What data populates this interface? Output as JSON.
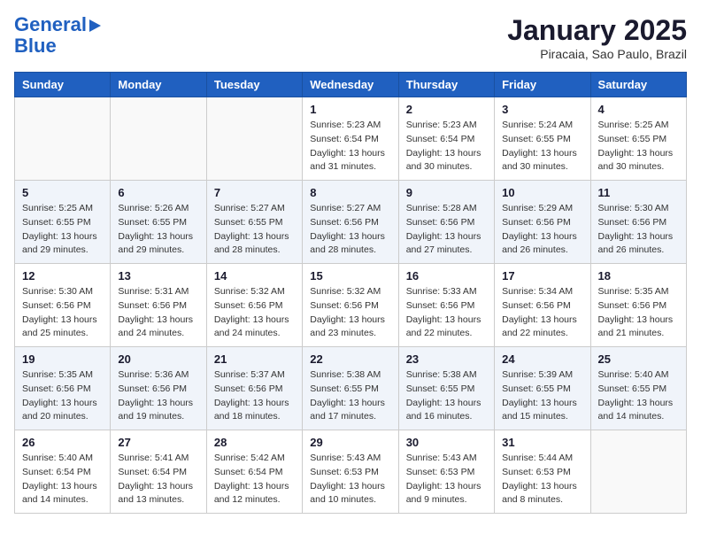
{
  "header": {
    "logo_line1": "General",
    "logo_line2": "Blue",
    "month_title": "January 2025",
    "subtitle": "Piracaia, Sao Paulo, Brazil"
  },
  "weekdays": [
    "Sunday",
    "Monday",
    "Tuesday",
    "Wednesday",
    "Thursday",
    "Friday",
    "Saturday"
  ],
  "weeks": [
    [
      {
        "day": "",
        "info": ""
      },
      {
        "day": "",
        "info": ""
      },
      {
        "day": "",
        "info": ""
      },
      {
        "day": "1",
        "info": "Sunrise: 5:23 AM\nSunset: 6:54 PM\nDaylight: 13 hours and 31 minutes."
      },
      {
        "day": "2",
        "info": "Sunrise: 5:23 AM\nSunset: 6:54 PM\nDaylight: 13 hours and 30 minutes."
      },
      {
        "day": "3",
        "info": "Sunrise: 5:24 AM\nSunset: 6:55 PM\nDaylight: 13 hours and 30 minutes."
      },
      {
        "day": "4",
        "info": "Sunrise: 5:25 AM\nSunset: 6:55 PM\nDaylight: 13 hours and 30 minutes."
      }
    ],
    [
      {
        "day": "5",
        "info": "Sunrise: 5:25 AM\nSunset: 6:55 PM\nDaylight: 13 hours and 29 minutes."
      },
      {
        "day": "6",
        "info": "Sunrise: 5:26 AM\nSunset: 6:55 PM\nDaylight: 13 hours and 29 minutes."
      },
      {
        "day": "7",
        "info": "Sunrise: 5:27 AM\nSunset: 6:55 PM\nDaylight: 13 hours and 28 minutes."
      },
      {
        "day": "8",
        "info": "Sunrise: 5:27 AM\nSunset: 6:56 PM\nDaylight: 13 hours and 28 minutes."
      },
      {
        "day": "9",
        "info": "Sunrise: 5:28 AM\nSunset: 6:56 PM\nDaylight: 13 hours and 27 minutes."
      },
      {
        "day": "10",
        "info": "Sunrise: 5:29 AM\nSunset: 6:56 PM\nDaylight: 13 hours and 26 minutes."
      },
      {
        "day": "11",
        "info": "Sunrise: 5:30 AM\nSunset: 6:56 PM\nDaylight: 13 hours and 26 minutes."
      }
    ],
    [
      {
        "day": "12",
        "info": "Sunrise: 5:30 AM\nSunset: 6:56 PM\nDaylight: 13 hours and 25 minutes."
      },
      {
        "day": "13",
        "info": "Sunrise: 5:31 AM\nSunset: 6:56 PM\nDaylight: 13 hours and 24 minutes."
      },
      {
        "day": "14",
        "info": "Sunrise: 5:32 AM\nSunset: 6:56 PM\nDaylight: 13 hours and 24 minutes."
      },
      {
        "day": "15",
        "info": "Sunrise: 5:32 AM\nSunset: 6:56 PM\nDaylight: 13 hours and 23 minutes."
      },
      {
        "day": "16",
        "info": "Sunrise: 5:33 AM\nSunset: 6:56 PM\nDaylight: 13 hours and 22 minutes."
      },
      {
        "day": "17",
        "info": "Sunrise: 5:34 AM\nSunset: 6:56 PM\nDaylight: 13 hours and 22 minutes."
      },
      {
        "day": "18",
        "info": "Sunrise: 5:35 AM\nSunset: 6:56 PM\nDaylight: 13 hours and 21 minutes."
      }
    ],
    [
      {
        "day": "19",
        "info": "Sunrise: 5:35 AM\nSunset: 6:56 PM\nDaylight: 13 hours and 20 minutes."
      },
      {
        "day": "20",
        "info": "Sunrise: 5:36 AM\nSunset: 6:56 PM\nDaylight: 13 hours and 19 minutes."
      },
      {
        "day": "21",
        "info": "Sunrise: 5:37 AM\nSunset: 6:56 PM\nDaylight: 13 hours and 18 minutes."
      },
      {
        "day": "22",
        "info": "Sunrise: 5:38 AM\nSunset: 6:55 PM\nDaylight: 13 hours and 17 minutes."
      },
      {
        "day": "23",
        "info": "Sunrise: 5:38 AM\nSunset: 6:55 PM\nDaylight: 13 hours and 16 minutes."
      },
      {
        "day": "24",
        "info": "Sunrise: 5:39 AM\nSunset: 6:55 PM\nDaylight: 13 hours and 15 minutes."
      },
      {
        "day": "25",
        "info": "Sunrise: 5:40 AM\nSunset: 6:55 PM\nDaylight: 13 hours and 14 minutes."
      }
    ],
    [
      {
        "day": "26",
        "info": "Sunrise: 5:40 AM\nSunset: 6:54 PM\nDaylight: 13 hours and 14 minutes."
      },
      {
        "day": "27",
        "info": "Sunrise: 5:41 AM\nSunset: 6:54 PM\nDaylight: 13 hours and 13 minutes."
      },
      {
        "day": "28",
        "info": "Sunrise: 5:42 AM\nSunset: 6:54 PM\nDaylight: 13 hours and 12 minutes."
      },
      {
        "day": "29",
        "info": "Sunrise: 5:43 AM\nSunset: 6:53 PM\nDaylight: 13 hours and 10 minutes."
      },
      {
        "day": "30",
        "info": "Sunrise: 5:43 AM\nSunset: 6:53 PM\nDaylight: 13 hours and 9 minutes."
      },
      {
        "day": "31",
        "info": "Sunrise: 5:44 AM\nSunset: 6:53 PM\nDaylight: 13 hours and 8 minutes."
      },
      {
        "day": "",
        "info": ""
      }
    ]
  ]
}
